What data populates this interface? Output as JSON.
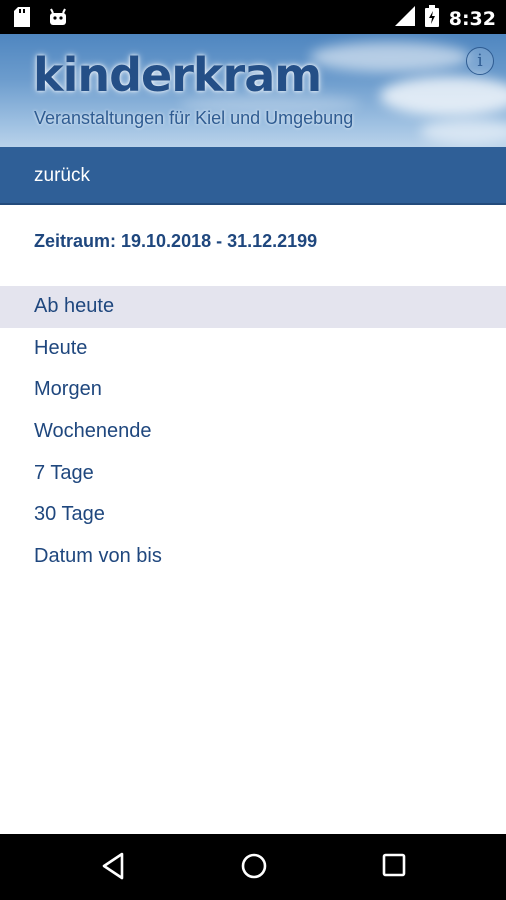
{
  "status_bar": {
    "time": "8:32",
    "icons": [
      "sd-card-icon",
      "android-icon",
      "signal-icon",
      "battery-icon"
    ]
  },
  "header": {
    "logo": "kinderkram",
    "subtitle": "Veranstaltungen für Kiel und Umgebung",
    "info_icon": "info-icon"
  },
  "backbar": {
    "back_label": "zurück"
  },
  "period": {
    "text": "Zeitraum: 19.10.2018 - 31.12.2199"
  },
  "menu": {
    "selected_index": 0,
    "items": [
      {
        "label": "Ab heute"
      },
      {
        "label": "Heute"
      },
      {
        "label": "Morgen"
      },
      {
        "label": "Wochenende"
      },
      {
        "label": "7 Tage"
      },
      {
        "label": "30 Tage"
      },
      {
        "label": "Datum von bis"
      }
    ]
  },
  "nav_bar": {
    "buttons": [
      "back-icon",
      "home-icon",
      "recents-icon"
    ]
  },
  "colors": {
    "accent": "#2f5f97",
    "text": "#1f477e",
    "selected_bg": "#e4e4ee"
  }
}
